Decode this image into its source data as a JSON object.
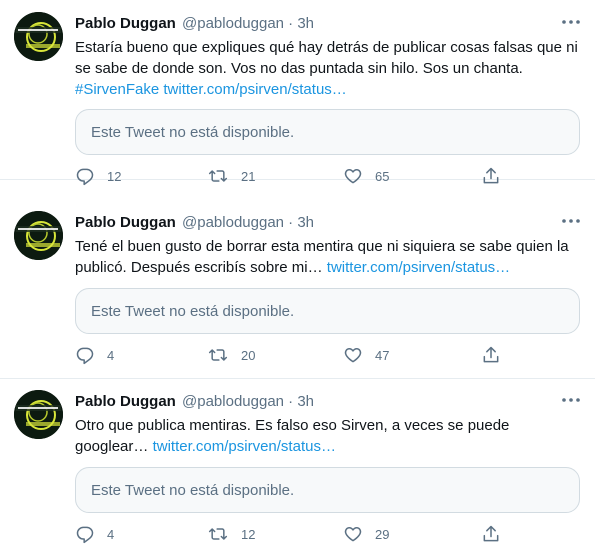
{
  "tweets": [
    {
      "name": "Pablo Duggan",
      "handle": "@pabloduggan",
      "sep": "·",
      "time": "3h",
      "text": "Estaría bueno que expliques qué hay detrás de publicar cosas falsas que ni se sabe de donde son. Vos no das puntada sin hilo. Sos un chanta.",
      "hashtag": "#SirvenFake",
      "link": "twitter.com/psirven/status…",
      "quoted": "Este Tweet no está disponible.",
      "replies": "12",
      "retweets": "21",
      "likes": "65"
    },
    {
      "name": "Pablo Duggan",
      "handle": "@pabloduggan",
      "sep": "·",
      "time": "3h",
      "text": "Tené el buen gusto de borrar esta mentira que ni siquiera se sabe quien la publicó. Después escribís sobre mi…",
      "link": "twitter.com/psirven/status…",
      "quoted": "Este Tweet no está disponible.",
      "replies": "4",
      "retweets": "20",
      "likes": "47"
    },
    {
      "name": "Pablo Duggan",
      "handle": "@pabloduggan",
      "sep": "·",
      "time": "3h",
      "text": "Otro que publica mentiras. Es falso eso Sirven, a veces se puede googlear…",
      "link": "twitter.com/psirven/status…",
      "quoted": "Este Tweet no está disponible.",
      "replies": "4",
      "retweets": "12",
      "likes": "29"
    }
  ],
  "avatar": {
    "logo_text": [
      "LA PERSECUCIÓN",
      "LA VENDETTE"
    ],
    "colors": {
      "background": "#0c1a10",
      "accent": "#d8e63a"
    }
  },
  "icons": [
    "reply-icon",
    "retweet-icon",
    "like-icon",
    "share-icon",
    "more-icon"
  ],
  "colors": {
    "link": "#1b95e0",
    "muted": "#5b7083",
    "text": "#0f1419",
    "border": "#e6ecf0"
  }
}
